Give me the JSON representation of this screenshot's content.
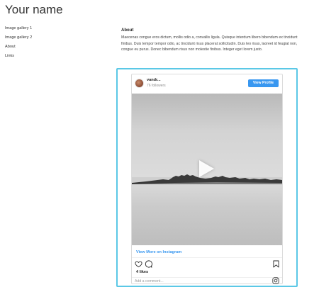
{
  "site": {
    "title": "Your name"
  },
  "nav": {
    "items": [
      {
        "label": "Image gallery 1"
      },
      {
        "label": "Image gallery 2"
      },
      {
        "label": "About"
      },
      {
        "label": "Links"
      }
    ]
  },
  "about": {
    "heading": "About",
    "body": "Maecenas congue eros dictum, mollis odio a, convallis ligula. Quisque interdum libero bibendum ex tincidunt finibus. Duis tempor tempor odio, ac tincidunt risus placerat sollicitudin. Duis leo risus, laoreet id feugiat non, congue eu purus. Donec bibendum risus non molestie finibus. Integer eget lorem justo."
  },
  "instagram": {
    "username": "vandr...",
    "followers": "76 followers",
    "view_profile_label": "View Profile",
    "view_more_label": "View More on Instagram",
    "likes": "4 likes",
    "comment_placeholder": "Add a comment...",
    "icons": [
      "heart-icon",
      "comment-icon",
      "bookmark-icon",
      "instagram-icon",
      "play-icon"
    ],
    "colors": {
      "accent": "#3897f0",
      "frame": "#5bc8e6"
    }
  }
}
